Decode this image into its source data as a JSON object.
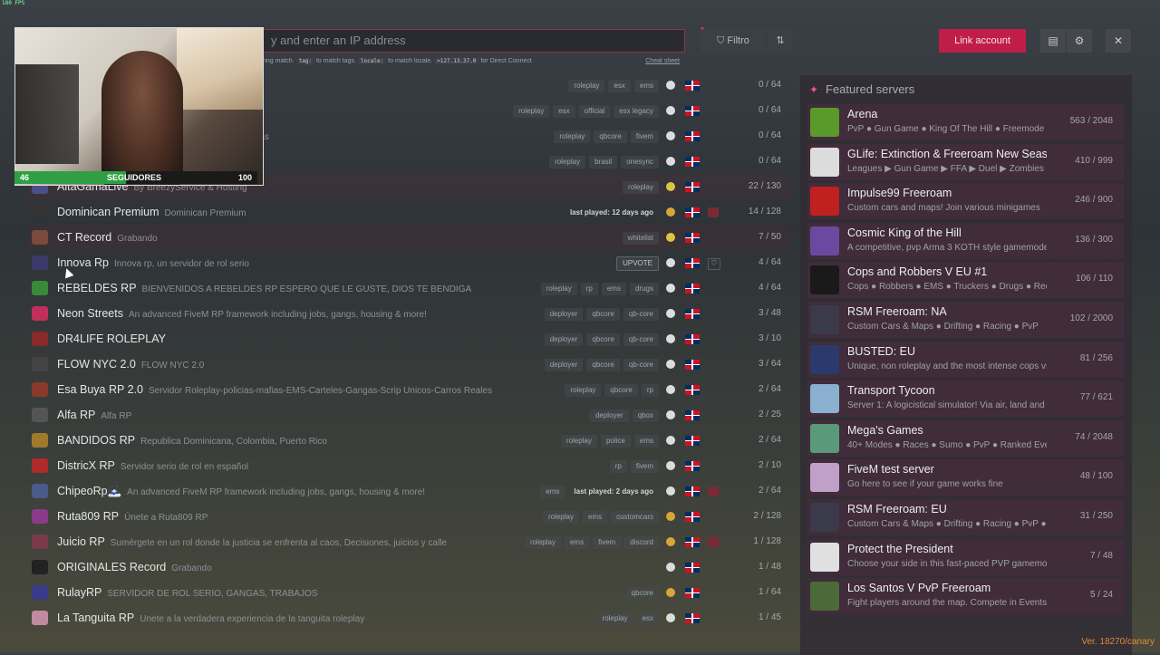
{
  "fps": "180 FPS",
  "search": {
    "placeholder_text": "y and enter an IP address",
    "hint": "ring match.",
    "hint_tag_code": "tag:",
    "hint_tag_text": "to match tags.",
    "hint_locale_code": "locale:",
    "hint_locale_text": "to match locale.",
    "hint_ip_code": ">127.13.37.0",
    "hint_ip_text": "for Direct Connect",
    "cheat_sheet": "Cheat sheet"
  },
  "toolbar": {
    "filter_label": "Filtro",
    "sort_icon": "sort-icon",
    "link_account": "Link account",
    "icons": [
      "list-icon",
      "gear-icon",
      "close-icon"
    ]
  },
  "webcam": {
    "followers_current": "46",
    "followers_label": "SEGUIDORES",
    "followers_goal": "100",
    "progress_fraction": 0.46
  },
  "servers": [
    {
      "name": "",
      "desc": "el 1",
      "tags": [
        "roleplay",
        "esx",
        "ems"
      ],
      "players": "0 / 64",
      "alt": false,
      "logo": "#555"
    },
    {
      "name": "",
      "desc": "A COLOMBIA PR ROL 100% GARANTIZADO!",
      "tags": [
        "roleplay",
        "esx",
        "official",
        "esx legacy"
      ],
      "players": "0 / 64",
      "alt": false,
      "logo": "#555"
    },
    {
      "name": "",
      "desc": "ales, sistema de policia activo, bandas organizadas",
      "tags": [
        "roleplay",
        "qbcore",
        "fivem"
      ],
      "players": "0 / 64",
      "alt": false,
      "logo": "#555"
    },
    {
      "name": "",
      "desc": "",
      "tags": [
        "roleplay",
        "brasil",
        "onesync"
      ],
      "players": "0 / 64",
      "alt": false,
      "logo": "#555"
    },
    {
      "name": "AltaGamaLive",
      "desc": "By BreezyService & Hosting",
      "tags": [
        "roleplay"
      ],
      "players": "22 / 130",
      "alt": true,
      "logo": "#4a4f8a",
      "icon": "sun"
    },
    {
      "name": "Dominican Premium",
      "desc": "Dominican Premium",
      "tags": [
        "last played: 12 days ago"
      ],
      "players": "14 / 128",
      "alt": false,
      "logo": "#333",
      "icon": "gold",
      "extra": "box"
    },
    {
      "name": "CT Record",
      "desc": "Grabando",
      "tags": [
        "whitelist"
      ],
      "players": "7 / 50",
      "alt": true,
      "logo": "#7a4a3a",
      "icon": "sun"
    },
    {
      "name": "Innova Rp",
      "desc": "Innova rp, un servidor de rol serio",
      "tags": [
        "UPVOTE"
      ],
      "players": "4 / 64",
      "alt": false,
      "logo": "#3a3a6a",
      "extra": "heart"
    },
    {
      "name": "REBELDES RP",
      "desc": "BIENVENIDOS A REBELDES RP ESPERO QUE LE GUSTE, DIOS TE BENDIGA",
      "tags": [
        "roleplay",
        "rp",
        "ems",
        "drugs"
      ],
      "players": "4 / 64",
      "alt": false,
      "logo": "#3a8a3a"
    },
    {
      "name": "Neon Streets",
      "desc": "An advanced FiveM RP framework including jobs, gangs, housing & more!",
      "tags": [
        "deployer",
        "qbcore",
        "qb-core"
      ],
      "players": "3 / 48",
      "alt": false,
      "logo": "#c0305a"
    },
    {
      "name": "DR4LIFE ROLEPLAY",
      "desc": "",
      "tags": [
        "deployer",
        "qbcore",
        "qb-core"
      ],
      "players": "3 / 10",
      "alt": false,
      "logo": "#8a2a2a"
    },
    {
      "name": "FLOW NYC 2.0",
      "desc": "FLOW NYC 2.0",
      "tags": [
        "deployer",
        "qbcore",
        "qb-core"
      ],
      "players": "3 / 64",
      "alt": false,
      "logo": "#444"
    },
    {
      "name": "Esa Buya RP 2.0",
      "desc": "Servidor Roleplay-policias-mafias-EMS-Carteles-Gangas-Scrip Unicos-Carros Reales",
      "tags": [
        "roleplay",
        "qbcore",
        "rp"
      ],
      "players": "2 / 64",
      "alt": false,
      "logo": "#8a3a2a"
    },
    {
      "name": "Alfa RP",
      "desc": "Alfa RP",
      "tags": [
        "deployer",
        "qbox"
      ],
      "players": "2 / 25",
      "alt": false,
      "logo": "#555"
    },
    {
      "name": "BANDIDOS RP",
      "desc": "Republica Dominicana, Colombia, Puerto Rico",
      "tags": [
        "roleplay",
        "police",
        "ems"
      ],
      "players": "2 / 64",
      "alt": false,
      "logo": "#a07a2a"
    },
    {
      "name": "DistricX RP",
      "desc": "Servidor serio de rol en español",
      "tags": [
        "rp",
        "fivem"
      ],
      "players": "2 / 10",
      "alt": false,
      "logo": "#b02a2a"
    },
    {
      "name": "ChipeoRp🗻",
      "desc": "An advanced FiveM RP framework including jobs, gangs, housing & more!",
      "tags": [
        "ems",
        "last played: 2 days ago"
      ],
      "players": "2 / 64",
      "alt": false,
      "logo": "#4a5a8a",
      "extra": "box"
    },
    {
      "name": "Ruta809 RP",
      "desc": "Únete a Ruta809 RP",
      "tags": [
        "roleplay",
        "ems",
        "customcars"
      ],
      "players": "2 / 128",
      "alt": false,
      "logo": "#8a3a8a",
      "icon": "gold"
    },
    {
      "name": "Juicio RP",
      "desc": "Sumérgete en un rol donde la justicia se enfrenta al caos, Decisiones, juicios y calle",
      "tags": [
        "roleplay",
        "ems",
        "fivem",
        "discord"
      ],
      "players": "1 / 128",
      "alt": false,
      "logo": "#7a3a4a",
      "icon": "gold",
      "extra": "box"
    },
    {
      "name": "ORIGINALES Record",
      "desc": "Grabando",
      "tags": [],
      "players": "1 / 48",
      "alt": false,
      "logo": "#222"
    },
    {
      "name": "RulayRP",
      "desc": "SERVIDOR DE ROL SERIO, GANGAS, TRABAJOS",
      "tags": [
        "qbcore"
      ],
      "players": "1 / 64",
      "alt": false,
      "logo": "#3a3a8a",
      "icon": "gold"
    },
    {
      "name": "La Tanguita RP",
      "desc": "Unete a la verdadera experiencia de la tanguita roleplay",
      "tags": [
        "roleplay",
        "esx"
      ],
      "players": "1 / 45",
      "alt": false,
      "logo": "#c08aa0"
    }
  ],
  "featured": {
    "title": "Featured servers",
    "items": [
      {
        "title": "Arena",
        "desc": "PvP ● Gun Game ● King Of The Hill ● Freemode",
        "players": "563 / 2048",
        "logo": "#5a9a2a"
      },
      {
        "title": "GLife: Extinction & Freeroam New Season",
        "desc": "Leagues ▶ Gun Game ▶ FFA ▶ Duel ▶ Zombies",
        "players": "410 / 999",
        "logo": "#dcdcdc"
      },
      {
        "title": "Impulse99 Freeroam",
        "desc": "Custom cars and maps! Join various minigames",
        "players": "246 / 900",
        "logo": "#c02020"
      },
      {
        "title": "Cosmic King of the Hill",
        "desc": "A competitive, pvp Arma 3 KOTH style gamemode",
        "players": "136 / 300",
        "logo": "#6a4aa0"
      },
      {
        "title": "Cops and Robbers V EU #1",
        "desc": "Cops ● Robbers ● EMS ● Truckers ● Drugs ● Redzone",
        "players": "106 / 110",
        "logo": "#1a1a1a"
      },
      {
        "title": "RSM Freeroam: NA",
        "desc": "Custom Cars & Maps ● Drifting ● Racing ● PvP",
        "players": "102 / 2000",
        "logo": "#3a3a4a"
      },
      {
        "title": "BUSTED: EU",
        "desc": "Unique, non roleplay and the most intense cops vs",
        "players": "81 / 256",
        "logo": "#2a3a6a"
      },
      {
        "title": "Transport Tycoon",
        "desc": "Server 1: A logicistical simulator! Via air, land and sea",
        "players": "77 / 621",
        "logo": "#8ab0d0"
      },
      {
        "title": "Mega's Games",
        "desc": "40+ Modes ● Races ● Sumo ● PvP ● Ranked Events",
        "players": "74 / 2048",
        "logo": "#5a9a7a"
      },
      {
        "title": "FiveM test server",
        "desc": "Go here to see if your game works fine",
        "players": "48 / 100",
        "logo": "#c0a0c8"
      },
      {
        "title": "RSM Freeroam: EU",
        "desc": "Custom Cars & Maps ● Drifting ● Racing ● PvP ●",
        "players": "31 / 250",
        "logo": "#3a3a4a"
      },
      {
        "title": "Protect the President",
        "desc": "Choose your side in this fast-paced PVP gamemode",
        "players": "7 / 48",
        "logo": "#e0e0e0"
      },
      {
        "title": "Los Santos V PvP Freeroam",
        "desc": "Fight players around the map. Compete in Events and",
        "players": "5 / 24",
        "logo": "#4a6a3a"
      }
    ]
  },
  "version": "Ver. 18270/canary"
}
